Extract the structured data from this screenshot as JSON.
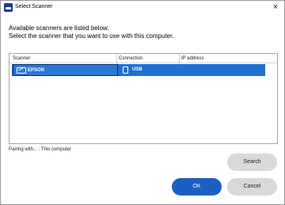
{
  "window": {
    "title": "Select Scanner",
    "close_glyph": "×"
  },
  "description": {
    "line1": "Available scanners are listed below.",
    "line2": "Select the scanner that you want to use with this computer."
  },
  "table": {
    "columns": [
      "Scanner",
      "Connection",
      "IP address"
    ],
    "rows": [
      {
        "scanner": "EPSON",
        "scanner_icon": "scanner-icon",
        "connection": "USB",
        "connection_icon": "usb-icon",
        "ip": ""
      }
    ]
  },
  "pairing_text": "Pairing with... : This computer",
  "buttons": {
    "search": "Search",
    "ok": "OK",
    "cancel": "Cancel"
  },
  "colors": {
    "accent": "#1b5fc2",
    "selection": "#1f70d2",
    "button_gray": "#d9d9d9"
  }
}
